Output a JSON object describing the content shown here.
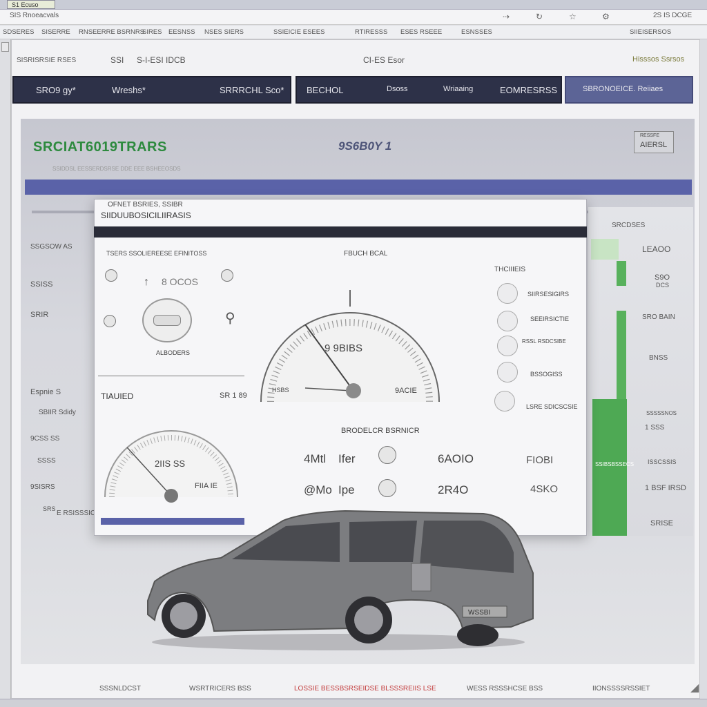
{
  "browser": {
    "tab_title": "S1 Ecuso",
    "address": "SIS Rnoeacvals",
    "toolbar_icons": [
      "nav-icon",
      "refresh-icon",
      "star-icon",
      "settings-icon"
    ],
    "toolbar_right": "2S IS DCGE"
  },
  "menu": {
    "items": [
      "SDSERES",
      "SISERRE",
      "RNSEERRE BSRNRS",
      "SIRES",
      "EESNSS",
      "NSES SIERS",
      "SSIEICIE ESEES",
      "RTIRESSS",
      "ESES RSEEE",
      "ESNSSES"
    ],
    "right": "SIIEISERSOS"
  },
  "header": {
    "left_label": "SISRISRSIE RSES",
    "mid_a": "SSI",
    "mid_b": "S-I-ESI IDCB",
    "center": "CI-ES Esor",
    "right": "Hisssos Ssrsos"
  },
  "nav": {
    "tab1_a": "SRO9 gy*",
    "tab1_b": "Wreshs*",
    "tab1_c": "SRRRCHL Sco*",
    "tab2_a": "BECHOL",
    "tab2_b": "Dsoss",
    "tab2_c": "Wriaaing",
    "tab2_d": "EOMRESRSS",
    "tab3": "SBRONOEICE. Reiiaes"
  },
  "banner": {
    "brand": "SRCIAT6019TRARS",
    "model": "9S6B0Y 1",
    "badge_top": "RESSFE",
    "badge_bottom": "AIERSL",
    "sub": "SSIDDSL EESSERDSRSE DDE EEE BSHEEOSDS"
  },
  "sidebar_left": {
    "items": [
      "SSGSOW AS",
      "SSISS",
      "SRIR",
      "Espnie S",
      "SBIIR Sdidy",
      "9CSS SS",
      "SSSS",
      "9SISRS",
      "SRS",
      "E RSISSSICS"
    ]
  },
  "dialog": {
    "title_1": "OFNET BSRIES, SSIBR",
    "title_2": "SIIDUUBOSICILIIRASIS",
    "left_heading": "TSERS SSOLIEREESE EFINITOSS",
    "center_heading": "FBUCH BCAL",
    "right_heading": "THCIIIEIS",
    "gauge_small_value": "8 OCOS",
    "gauge_small_caption": "ALBODERS",
    "trip_label": "TIAUIED",
    "trip_value": "SR 1 89",
    "main_gauge_value": "9 9BIBS",
    "main_gauge_min": "HSBS",
    "main_gauge_max": "9ACIE",
    "sub_heading": "BRODELCR BSRNICR",
    "stat_1a": "4Mtl",
    "stat_1b": "Ifer",
    "stat_1c": "6AOIO",
    "stat_1d": "FIOBI",
    "stat_2a": "@Mo",
    "stat_2b": "Ipe",
    "stat_2c": "2R4O",
    "stat_2d": "4SKO",
    "left_gauge_value": "2IIS SS",
    "left_gauge_tag": "FIIA IE",
    "right_items": [
      "SIIRSESIGIRS",
      "SEEIRSICTIE",
      "RSSL RSDCSIBE",
      "BSSOGISS",
      "LSRE SDICSCSIE"
    ]
  },
  "rightpanel": {
    "heading": "SRCDSES",
    "v1": "LEAOO",
    "v2a": "S9O",
    "v2b": "DCS",
    "v3": "SRO BAIN",
    "v4": "BNSS",
    "v5": "SSSSSNOS",
    "v6": "1 SSS",
    "v7": "ISSCSSIS",
    "v8": "SSIBSBSSECS",
    "v9": "1 BSF IRSD",
    "v10": "SRISE"
  },
  "car": {
    "plate": "WSSBI"
  },
  "footer": {
    "items": [
      "SSSNLDCST",
      "WSRTRICERS BSS",
      "LOSSIE BESSBSRSEIDSE BLSSSREIIS LSE",
      "WESS RSSSHCSE BSS",
      "IIONSSSSRSSIET"
    ]
  },
  "colors": {
    "nav_bg": "#2d3148",
    "accent_blue": "#5a62a8",
    "brand_green": "#2d8a3e",
    "bar_green": "#58b15c"
  }
}
